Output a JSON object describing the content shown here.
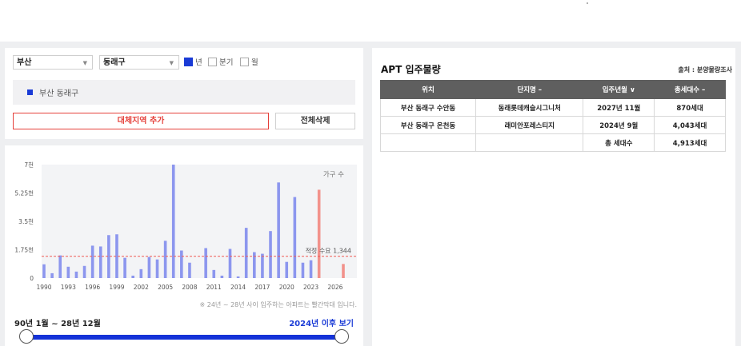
{
  "filters": {
    "city": "부산",
    "district": "동래구",
    "period_options": [
      {
        "label": "년",
        "checked": true
      },
      {
        "label": "분기",
        "checked": false
      },
      {
        "label": "월",
        "checked": false
      }
    ]
  },
  "selected_region": "부산 동래구",
  "buttons": {
    "add_region": "대체지역 추가",
    "delete_all": "전체삭제",
    "after_2024": "2024년 이후 보기"
  },
  "range_label": "90년 1월 ~ 28년 12월",
  "chart_note": "※ 24년 ~ 28년 사이 입주하는 아파트는 빨간막대 입니다.",
  "chart_data": {
    "type": "bar",
    "ylabel": "가구 수",
    "ylim": [
      0,
      7000
    ],
    "y_ticks": [
      "0",
      "1.75천",
      "3.5천",
      "5.25천",
      "7천"
    ],
    "x_ticks": [
      "1990",
      "1993",
      "1996",
      "1999",
      "2002",
      "2005",
      "2008",
      "2011",
      "2014",
      "2017",
      "2020",
      "2023",
      "2026"
    ],
    "reference_line": {
      "label": "적정 수요 1,344",
      "value": 1344
    },
    "colors": {
      "past": "#8c96ee",
      "future": "#f2928c",
      "reference": "#ef5b55"
    },
    "series": [
      {
        "x": 1990,
        "value": 850
      },
      {
        "x": 1991,
        "value": 300
      },
      {
        "x": 1992,
        "value": 1400
      },
      {
        "x": 1993,
        "value": 700
      },
      {
        "x": 1994,
        "value": 400
      },
      {
        "x": 1995,
        "value": 750
      },
      {
        "x": 1996,
        "value": 2000
      },
      {
        "x": 1997,
        "value": 1950
      },
      {
        "x": 1998,
        "value": 2650
      },
      {
        "x": 1999,
        "value": 2700
      },
      {
        "x": 2000,
        "value": 1250
      },
      {
        "x": 2001,
        "value": 150
      },
      {
        "x": 2002,
        "value": 550
      },
      {
        "x": 2003,
        "value": 1300
      },
      {
        "x": 2004,
        "value": 1150
      },
      {
        "x": 2005,
        "value": 2300
      },
      {
        "x": 2006,
        "value": 7000
      },
      {
        "x": 2007,
        "value": 1700
      },
      {
        "x": 2008,
        "value": 950
      },
      {
        "x": 2009,
        "value": 0
      },
      {
        "x": 2010,
        "value": 1850
      },
      {
        "x": 2011,
        "value": 500
      },
      {
        "x": 2012,
        "value": 150
      },
      {
        "x": 2013,
        "value": 1800
      },
      {
        "x": 2014,
        "value": 100
      },
      {
        "x": 2015,
        "value": 3100
      },
      {
        "x": 2016,
        "value": 1600
      },
      {
        "x": 2017,
        "value": 1500
      },
      {
        "x": 2018,
        "value": 2900
      },
      {
        "x": 2019,
        "value": 5900
      },
      {
        "x": 2020,
        "value": 1000
      },
      {
        "x": 2021,
        "value": 5000
      },
      {
        "x": 2022,
        "value": 950
      },
      {
        "x": 2023,
        "value": 1100
      },
      {
        "x": 2024,
        "value": 5450,
        "future": true
      },
      {
        "x": 2025,
        "value": 0,
        "future": true
      },
      {
        "x": 2026,
        "value": 0,
        "future": true
      },
      {
        "x": 2027,
        "value": 870,
        "future": true
      }
    ]
  },
  "apt_panel": {
    "title": "APT 입주물량",
    "source": "출처 : 분양물량조사",
    "headers": [
      "위치",
      "단지명 –",
      "입주년월 ∨",
      "총세대수 –"
    ],
    "rows": [
      [
        "부산 동래구 수안동",
        "동래롯데캐슬시그니처",
        "2027년 11월",
        "870세대"
      ],
      [
        "부산 동래구 온천동",
        "래미안포레스티지",
        "2024년 9월",
        "4,043세대"
      ],
      [
        "",
        "",
        "총 세대수",
        "4,913세대"
      ]
    ]
  }
}
